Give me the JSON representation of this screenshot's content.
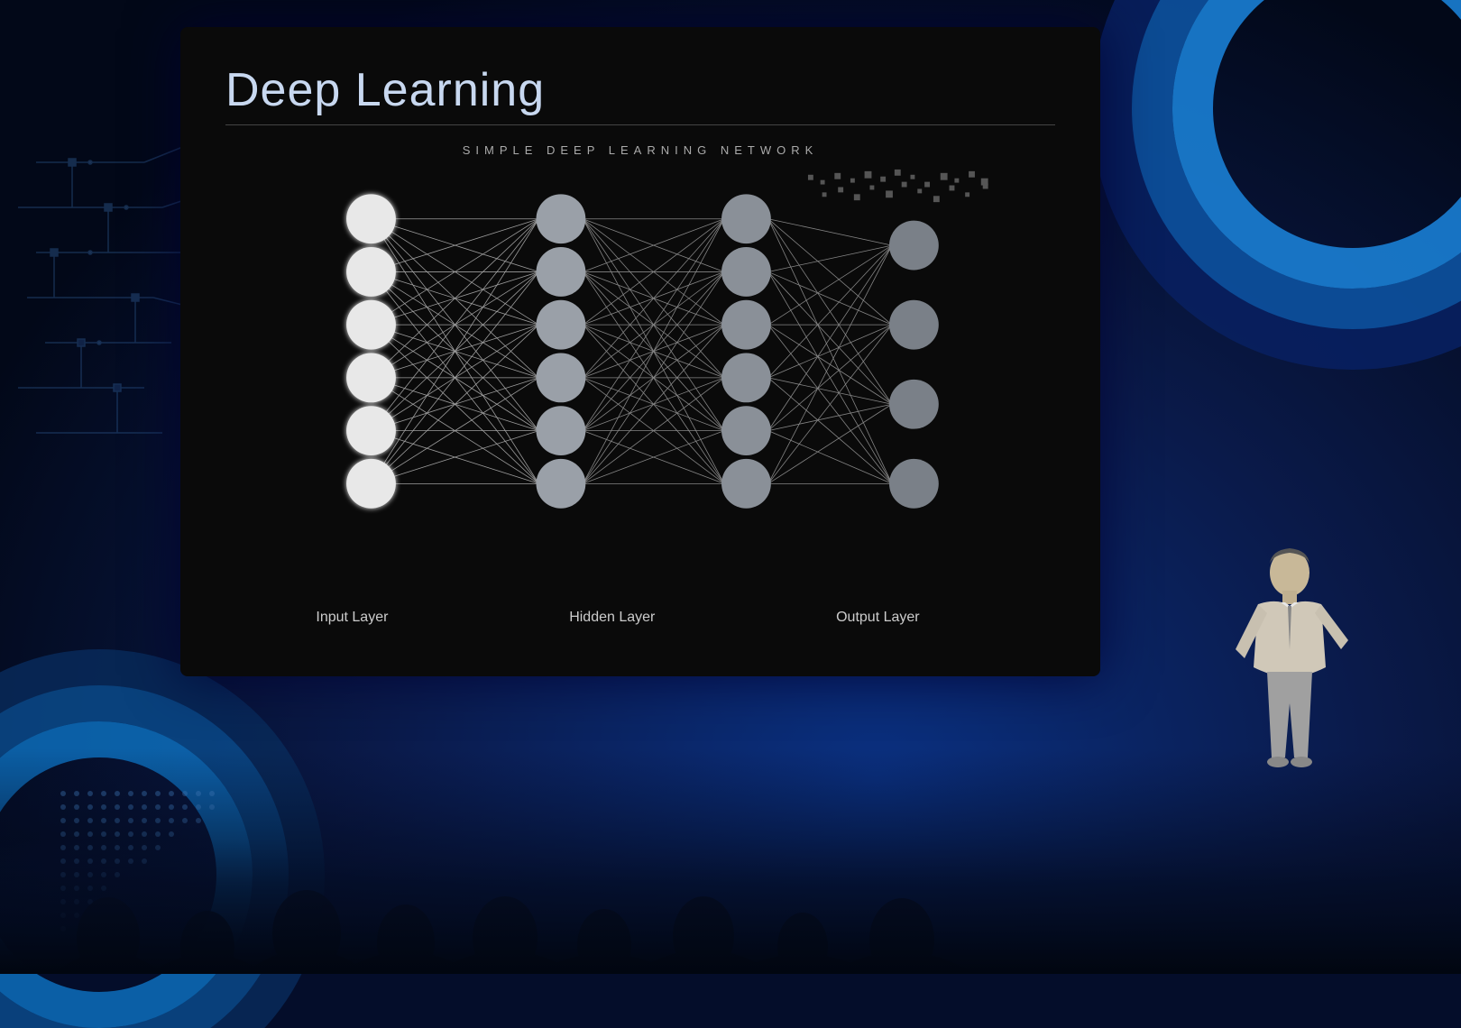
{
  "background": {
    "base_color": "#040d2a",
    "gradient_color": "#0a3080"
  },
  "slide": {
    "title": "Deep Learning",
    "network_subtitle": "SIMPLE DEEP LEARNING NETWORK",
    "layers": {
      "input_label": "Input Layer",
      "hidden_label": "Hidden Layer",
      "output_label": "Output Layer"
    }
  },
  "decorations": {
    "arc_color_outer": "#1a7fd4",
    "arc_color_mid": "#0d52a0",
    "arc_color_inner": "#082060",
    "dot_color": "#4a90d9",
    "circuit_color": "#2a5a9a"
  },
  "network": {
    "input_nodes": 6,
    "hidden1_nodes": 6,
    "hidden2_nodes": 6,
    "output_nodes": 4
  }
}
